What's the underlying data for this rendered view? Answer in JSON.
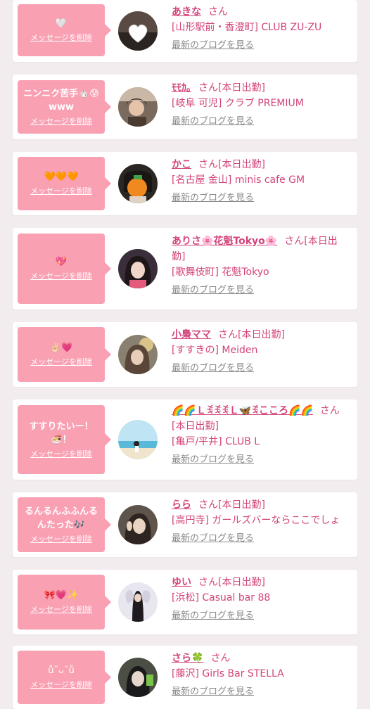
{
  "colors": {
    "accent": "#d3447a",
    "bubble": "#f9a0b3",
    "background": "#f2ecee"
  },
  "delete_label": "メッセージを削除",
  "blog_label": "最新のブログを見る",
  "items": [
    {
      "message": "",
      "message_icon": "🤍",
      "name": "あきな",
      "suffix": "さん",
      "shop": "[山形駅前・香澄町] CLUB ZU-ZU",
      "avatar_icon": "heart-sticker-avatar-icon"
    },
    {
      "message": "ニンニク苦手🧄😰www",
      "message_icon": "",
      "name": "ﾓﾓｶ｡",
      "suffix": "さん[本日出勤]",
      "shop": "[岐阜 可児] クラブ PREMIUM",
      "avatar_icon": "selfie-avatar-icon"
    },
    {
      "message": "",
      "message_icon": "🧡🧡🧡",
      "name": "かこ",
      "suffix": "さん[本日出勤]",
      "shop": "[名古屋 金山] minis cafe GM",
      "avatar_icon": "orange-face-avatar-icon"
    },
    {
      "message": "",
      "message_icon": "💖",
      "name": "ありさ🌸花魁Tokyo🌸",
      "suffix": "さん[本日出勤]",
      "shop": "[歌舞伎町] 花魁Tokyo",
      "avatar_icon": "portrait-avatar-icon"
    },
    {
      "message": "",
      "message_icon": "✌🏻💗",
      "name": "小梟ママ",
      "suffix": "さん[本日出勤]",
      "shop": "[すすきの] Meiden",
      "avatar_icon": "portrait-avatar-icon"
    },
    {
      "message": "すすりたいー！🍜！",
      "message_icon": "",
      "name": "🌈🌈ＬꉂꉂꉂＬ🦋ꉂこころ🌈🌈",
      "suffix": "さん[本日出勤]",
      "shop": "[亀戸/平井] CLUB L",
      "avatar_icon": "beach-avatar-icon"
    },
    {
      "message": "るんるんふふんるんたった🎶",
      "message_icon": "",
      "name": "らら",
      "suffix": "さん[本日出勤]",
      "shop": "[高円寺] ガールズバーならここでしょ",
      "avatar_icon": "peace-sign-avatar-icon"
    },
    {
      "message": "",
      "message_icon": "🎀💗✨",
      "name": "ゆい",
      "suffix": "さん[本日出勤]",
      "shop": "[浜松] Casual bar 88",
      "avatar_icon": "standing-avatar-icon"
    },
    {
      "message": "",
      "message_icon": "ů˘ᴗ˘ů",
      "name": "さら🍀",
      "suffix": "さん",
      "shop": "[藤沢] Girls Bar STELLA",
      "avatar_icon": "mirror-selfie-avatar-icon"
    }
  ]
}
